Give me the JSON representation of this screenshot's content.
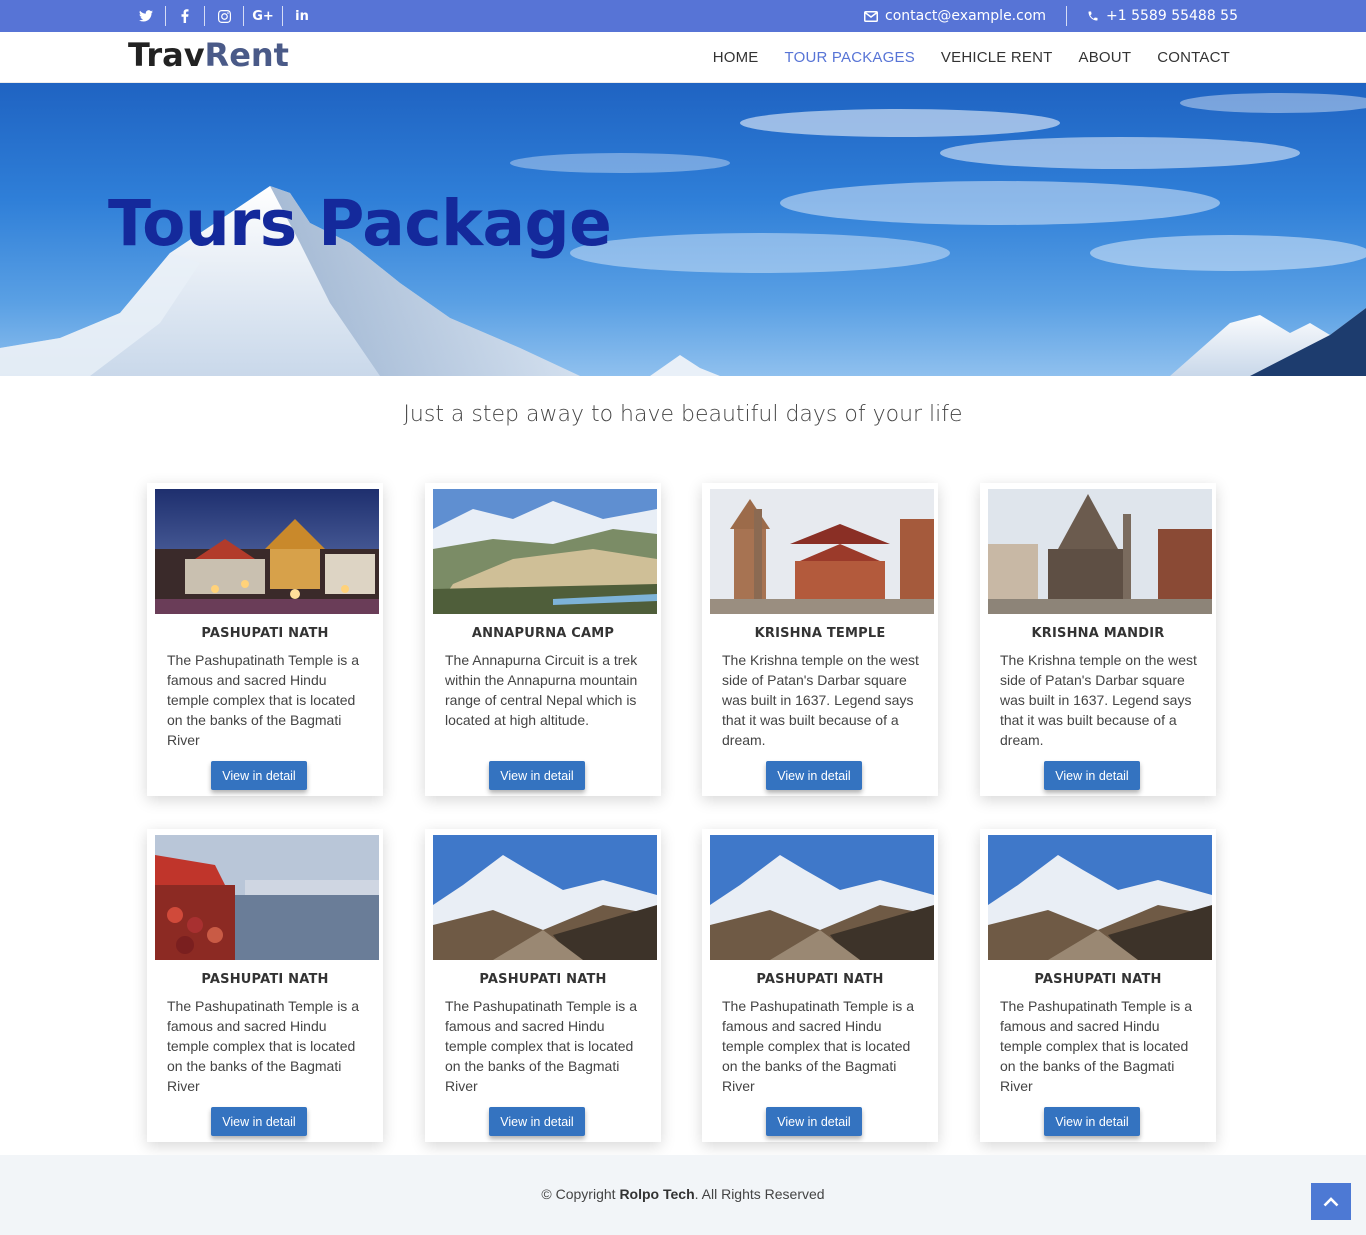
{
  "topbar": {
    "social_icons": [
      "twitter-icon",
      "facebook-icon",
      "instagram-icon",
      "google-plus-icon",
      "linkedin-icon"
    ],
    "social_text": [
      "G+",
      "in"
    ],
    "email": "contact@example.com",
    "phone": "+1 5589 55488 55"
  },
  "header": {
    "logo_part1": "Trav",
    "logo_part2": "Rent",
    "nav": [
      {
        "label": "HOME"
      },
      {
        "label": "TOUR PACKAGES"
      },
      {
        "label": "VEHICLE RENT"
      },
      {
        "label": "ABOUT"
      },
      {
        "label": "CONTACT"
      }
    ]
  },
  "hero": {
    "title": "Tours Package"
  },
  "tagline": "Just a step away to have beautiful days of your life",
  "cards": [
    {
      "title": "PASHUPATI NATH",
      "description": "The Pashupatinath Temple is a famous and sacred Hindu temple complex that is located on the banks of the Bagmati River",
      "button": "View in detail"
    },
    {
      "title": "ANNAPURNA CAMP",
      "description": "The Annapurna Circuit is a trek within the Annapurna mountain range of central Nepal which is located at high altitude.",
      "button": "View in detail"
    },
    {
      "title": "KRISHNA TEMPLE",
      "description": "The Krishna temple on the west side of Patan's Darbar square was built in 1637. Legend says that it was built because of a dream.",
      "button": "View in detail"
    },
    {
      "title": "KRISHNA MANDIR",
      "description": "The Krishna temple on the west side of Patan's Darbar square was built in 1637. Legend says that it was built because of a dream.",
      "button": "View in detail"
    },
    {
      "title": "PASHUPATI NATH",
      "description": "The Pashupatinath Temple is a famous and sacred Hindu temple complex that is located on the banks of the Bagmati River",
      "button": "View in detail"
    },
    {
      "title": "PASHUPATI NATH",
      "description": "The Pashupatinath Temple is a famous and sacred Hindu temple complex that is located on the banks of the Bagmati River",
      "button": "View in detail"
    },
    {
      "title": "PASHUPATI NATH",
      "description": "The Pashupatinath Temple is a famous and sacred Hindu temple complex that is located on the banks of the Bagmati River",
      "button": "View in detail"
    },
    {
      "title": "PASHUPATI NATH",
      "description": "The Pashupatinath Temple is a famous and sacred Hindu temple complex that is located on the banks of the Bagmati River",
      "button": "View in detail"
    }
  ],
  "footer": {
    "copyright_prefix": "© Copyright",
    "company": "Rolpo Tech",
    "copyright_suffix": ". All Rights Reserved"
  },
  "back_to_top_icon": "chevron-up-icon",
  "colors": {
    "topbar": "#5774d6",
    "nav_active": "#5774d6",
    "hero_title": "#14299b",
    "button": "#3473c0",
    "footer": "#f2f5f8"
  }
}
